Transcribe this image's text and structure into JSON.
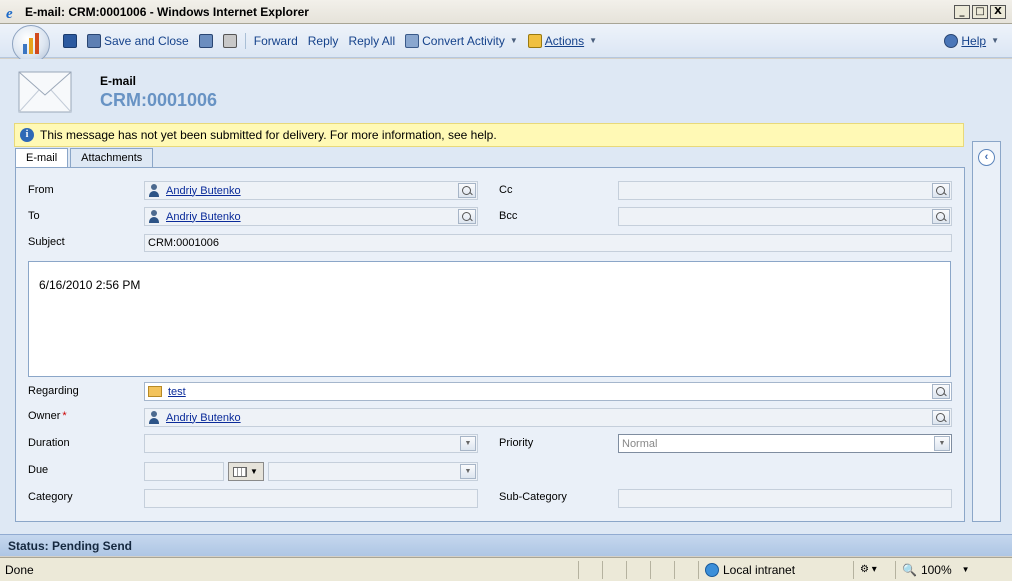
{
  "window": {
    "title": "E-mail: CRM:0001006 - Windows Internet Explorer",
    "min": "_",
    "max": "□",
    "close": "X"
  },
  "toolbar": {
    "save_close": "Save and Close",
    "forward": "Forward",
    "reply": "Reply",
    "reply_all": "Reply All",
    "convert": "Convert Activity",
    "actions": "Actions",
    "help": "Help"
  },
  "header": {
    "type": "E-mail",
    "title": "CRM:0001006"
  },
  "notice": {
    "text": "This message has not yet been submitted for delivery. For more information, see help."
  },
  "tabs": [
    {
      "label": "E-mail"
    },
    {
      "label": "Attachments"
    }
  ],
  "form": {
    "from": {
      "label": "From",
      "value": "Andriy Butenko"
    },
    "to": {
      "label": "To",
      "value": "Andriy Butenko"
    },
    "cc": {
      "label": "Cc",
      "value": ""
    },
    "bcc": {
      "label": "Bcc",
      "value": ""
    },
    "subject": {
      "label": "Subject",
      "value": "CRM:0001006"
    },
    "body": "6/16/2010 2:56 PM",
    "regarding": {
      "label": "Regarding",
      "value": "test"
    },
    "owner": {
      "label": "Owner",
      "required": "*",
      "value": "Andriy Butenko"
    },
    "duration": {
      "label": "Duration",
      "value": ""
    },
    "priority": {
      "label": "Priority",
      "value": "Normal"
    },
    "due": {
      "label": "Due",
      "value": ""
    },
    "category": {
      "label": "Category",
      "value": ""
    },
    "subcategory": {
      "label": "Sub-Category",
      "value": ""
    }
  },
  "status": {
    "text": "Status: Pending Send"
  },
  "ie_status": {
    "done": "Done",
    "zone": "Local intranet",
    "zoom": "100%"
  },
  "colors": {
    "accent": "#15428b",
    "title_blue": "#6893c4",
    "notice_bg": "#fff9b5"
  }
}
